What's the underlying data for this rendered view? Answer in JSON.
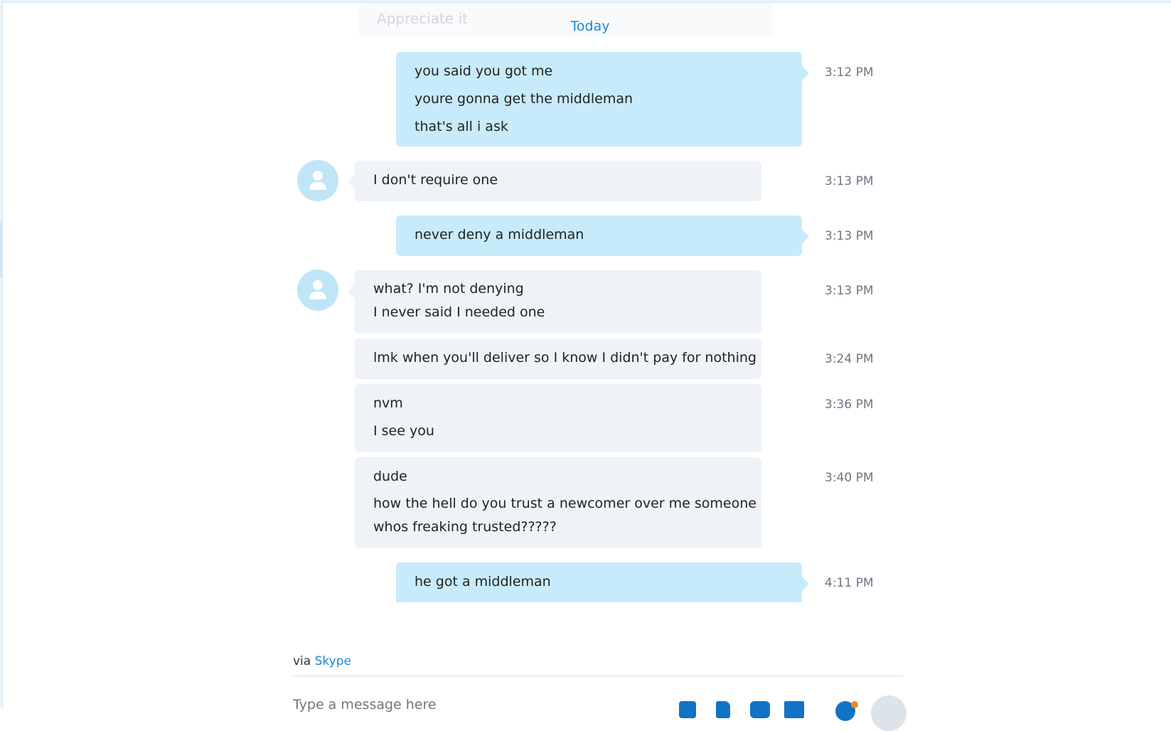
{
  "chat": {
    "previous_message_faded": "Appreciate it",
    "day_separator": "Today",
    "messages": [
      {
        "direction": "out",
        "lines": [
          "you said you got me",
          "youre gonna get the middleman",
          "that's all i ask"
        ],
        "time": "3:12 PM"
      },
      {
        "direction": "in",
        "lines": [
          "I don't require one"
        ],
        "time": "3:13 PM"
      },
      {
        "direction": "out",
        "lines": [
          "never deny a middleman"
        ],
        "time": "3:13 PM"
      },
      {
        "direction": "in",
        "lines": [
          "what? I'm not denying",
          "I never said I needed one"
        ],
        "time": "3:13 PM"
      },
      {
        "direction": "in",
        "lines": [
          "lmk when you'll deliver so I know I didn't pay for nothing"
        ],
        "time": "3:24 PM"
      },
      {
        "direction": "in",
        "lines": [
          "nvm",
          "I see you"
        ],
        "time": "3:36 PM"
      },
      {
        "direction": "in",
        "lines": [
          "dude",
          "how the hell do you trust a newcomer over me someone",
          "whos freaking trusted?????"
        ],
        "time": "3:40 PM"
      },
      {
        "direction": "out",
        "lines": [
          "he got a middleman"
        ],
        "time": "4:11 PM"
      }
    ]
  },
  "footer": {
    "via_prefix": "via",
    "via_link": "Skype",
    "composer_placeholder": "Type a message here",
    "icons": [
      "contact-card-icon",
      "file-icon",
      "video-message-icon",
      "media-bar-icon",
      "emoji-icon",
      "send-icon"
    ]
  },
  "colors": {
    "accent": "#1a8ad4",
    "outgoing_bubble": "#c7ebfa",
    "incoming_bubble": "#eff2f6",
    "avatar": "#bfe5f7",
    "icon_blue": "#1173c5",
    "notification_dot": "#f28a1c"
  }
}
